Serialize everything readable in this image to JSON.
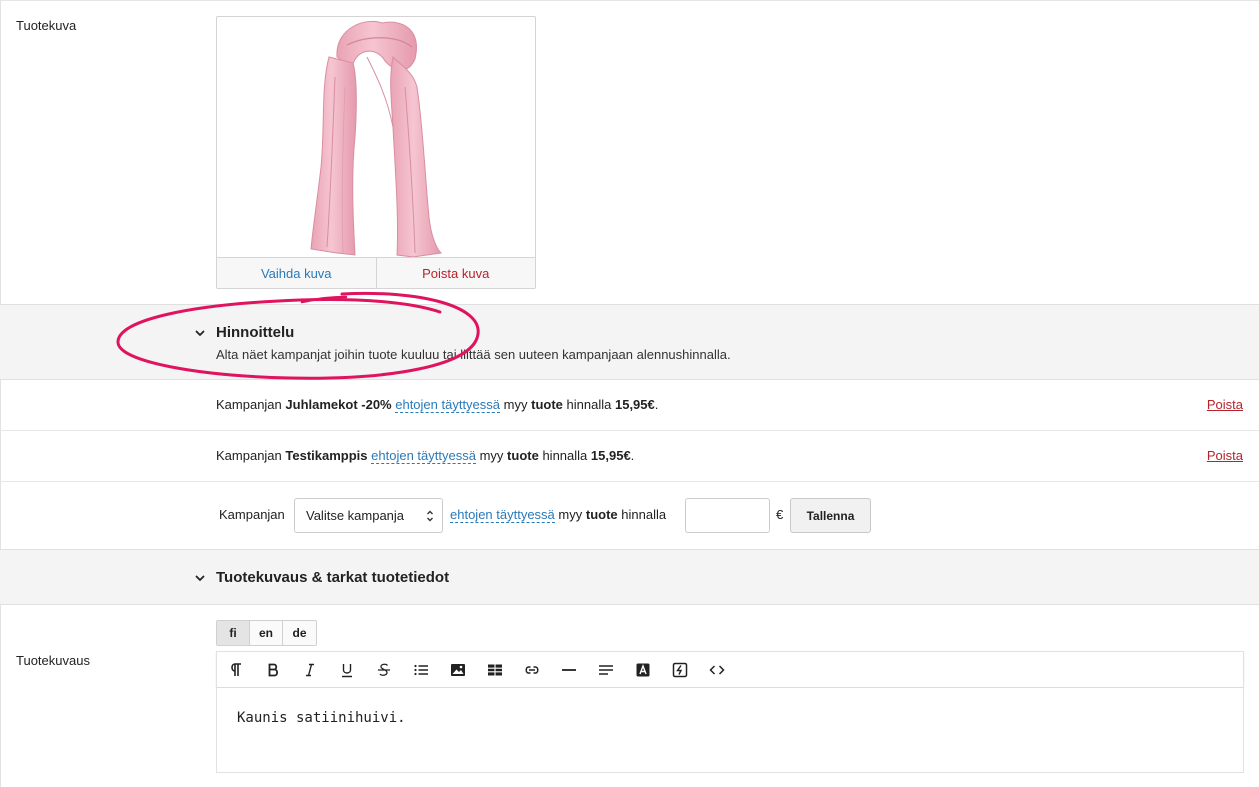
{
  "image_section": {
    "label": "Tuotekuva",
    "change_label": "Vaihda kuva",
    "remove_label": "Poista kuva"
  },
  "pricing": {
    "title": "Hinnoittelu",
    "description": "Alta näet kampanjat joihin tuote kuuluu tai liittää sen uuteen kampanjaan alennushinnalla.",
    "campaigns": [
      {
        "prefix": "Kampanjan",
        "name": "Juhlamekot -20%",
        "condition": "ehtojen täyttyessä",
        "mid": "myy",
        "product": "tuote",
        "mid2": "hinnalla",
        "price": "15,95€",
        "remove_label": "Poista"
      },
      {
        "prefix": "Kampanjan",
        "name": "Testikamppis",
        "condition": "ehtojen täyttyessä",
        "mid": "myy",
        "product": "tuote",
        "mid2": "hinnalla",
        "price": "15,95€",
        "remove_label": "Poista"
      }
    ],
    "new_campaign": {
      "prefix": "Kampanjan",
      "select_value": "Valitse kampanja",
      "condition": "ehtojen täyttyessä",
      "mid": "myy",
      "product": "tuote",
      "mid2": "hinnalla",
      "price_value": "",
      "currency": "€",
      "save_label": "Tallenna"
    }
  },
  "description_section": {
    "title": "Tuotekuvaus & tarkat tuotetiedot",
    "label": "Tuotekuvaus",
    "languages": [
      "fi",
      "en",
      "de"
    ],
    "active_language": "fi",
    "toolbar": [
      "paragraph-icon",
      "bold-icon",
      "italic-icon",
      "underline-icon",
      "strikethrough-icon",
      "list-icon",
      "image-icon",
      "table-icon",
      "link-icon",
      "horizontal-rule-icon",
      "align-icon",
      "font-color-icon",
      "clear-format-icon",
      "code-icon"
    ],
    "content": "Kaunis satiinihuivi."
  },
  "colors": {
    "link": "#2a7ab8",
    "danger": "#b8232b",
    "annotation": "#e0135f",
    "scarf": "#f0b3c2"
  }
}
